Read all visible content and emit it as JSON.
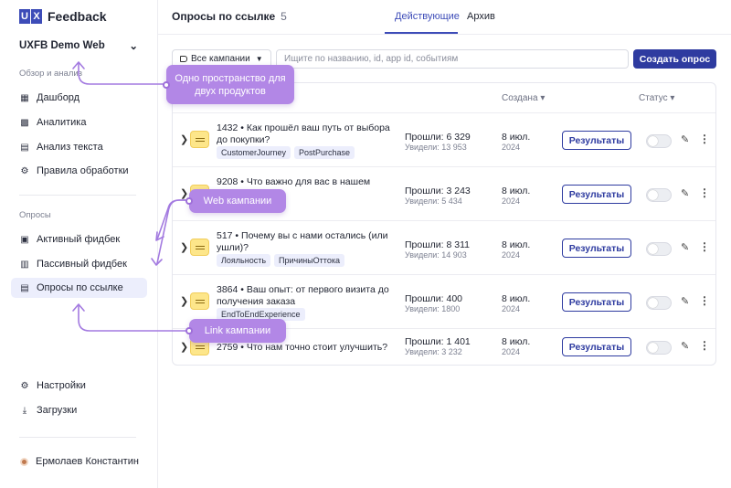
{
  "brand": {
    "logo_letters": [
      "U",
      "X"
    ],
    "name": "Feedback"
  },
  "workspace": {
    "name": "UXFB Demo Web"
  },
  "sidebar": {
    "section_overview": "Обзор и анализ",
    "overview_items": [
      {
        "label": "Дашборд",
        "icon": "grid-icon"
      },
      {
        "label": "Аналитика",
        "icon": "chart-icon"
      },
      {
        "label": "Анализ текста",
        "icon": "text-icon"
      },
      {
        "label": "Правила обработки",
        "icon": "rules-icon"
      }
    ],
    "section_surveys": "Опросы",
    "survey_items": [
      {
        "label": "Активный фидбек",
        "icon": "active-feedback-icon"
      },
      {
        "label": "Пассивный фидбек",
        "icon": "passive-feedback-icon"
      },
      {
        "label": "Опросы по ссылке",
        "icon": "link-survey-icon",
        "active": true
      }
    ],
    "bottom_items": [
      {
        "label": "Настройки",
        "icon": "gear-icon"
      },
      {
        "label": "Загрузки",
        "icon": "download-icon"
      }
    ],
    "user": {
      "name": "Ермолаев Константин"
    }
  },
  "header": {
    "title": "Опросы по ссылке",
    "count": "5",
    "tabs": [
      {
        "label": "Действующие",
        "active": true
      },
      {
        "label": "Архив",
        "active": false
      }
    ]
  },
  "toolbar": {
    "filter_label": "Все кампании",
    "search_placeholder": "Ищите по названию, id, app id, событиям",
    "create_label": "Создать опрос"
  },
  "table": {
    "columns": {
      "created": "Создана",
      "status": "Статус"
    },
    "rows": [
      {
        "title": "1432  •  Как прошёл ваш путь от выбора до покупки?",
        "tags": [
          "CustomerJourney",
          "PostPurchase"
        ],
        "passed": "Прошли: 6 329",
        "seen": "Увидели: 13 953",
        "date1": "8 июл.",
        "date2": "2024",
        "button": "Результаты"
      },
      {
        "title": "9208  •  Что важно для вас в нашем",
        "tags": [],
        "passed": "Прошли: 3 243",
        "seen": "Увидели: 5 434",
        "date1": "8 июл.",
        "date2": "2024",
        "button": "Результаты"
      },
      {
        "title": "517  •  Почему вы с нами остались (или ушли)?",
        "tags": [
          "Лояльность",
          "ПричиныОттока"
        ],
        "passed": "Прошли: 8 311",
        "seen": "Увидели: 14 903",
        "date1": "8 июл.",
        "date2": "2024",
        "button": "Результаты"
      },
      {
        "title": "3864  •  Ваш опыт: от первого визита до получения заказа",
        "tags": [
          "EndToEndExperience"
        ],
        "passed": "Прошли: 400",
        "seen": "Увидели: 1800",
        "date1": "8 июл.",
        "date2": "2024",
        "button": "Результаты"
      },
      {
        "title": "2759  •  Что нам точно стоит улучшить?",
        "tags": [],
        "passed": "Прошли: 1 401",
        "seen": "Увидели: 3 232",
        "date1": "8 июл.",
        "date2": "2024",
        "button": "Результаты"
      }
    ]
  },
  "callouts": {
    "workspace": "Одно пространство для двух продуктов",
    "web": "Web кампании",
    "link": "Link кампании"
  },
  "colors": {
    "accent": "#2e3ba0",
    "callout": "#b287e6",
    "tag_bg": "#eceefc",
    "survey_icon": "#fde68a"
  }
}
